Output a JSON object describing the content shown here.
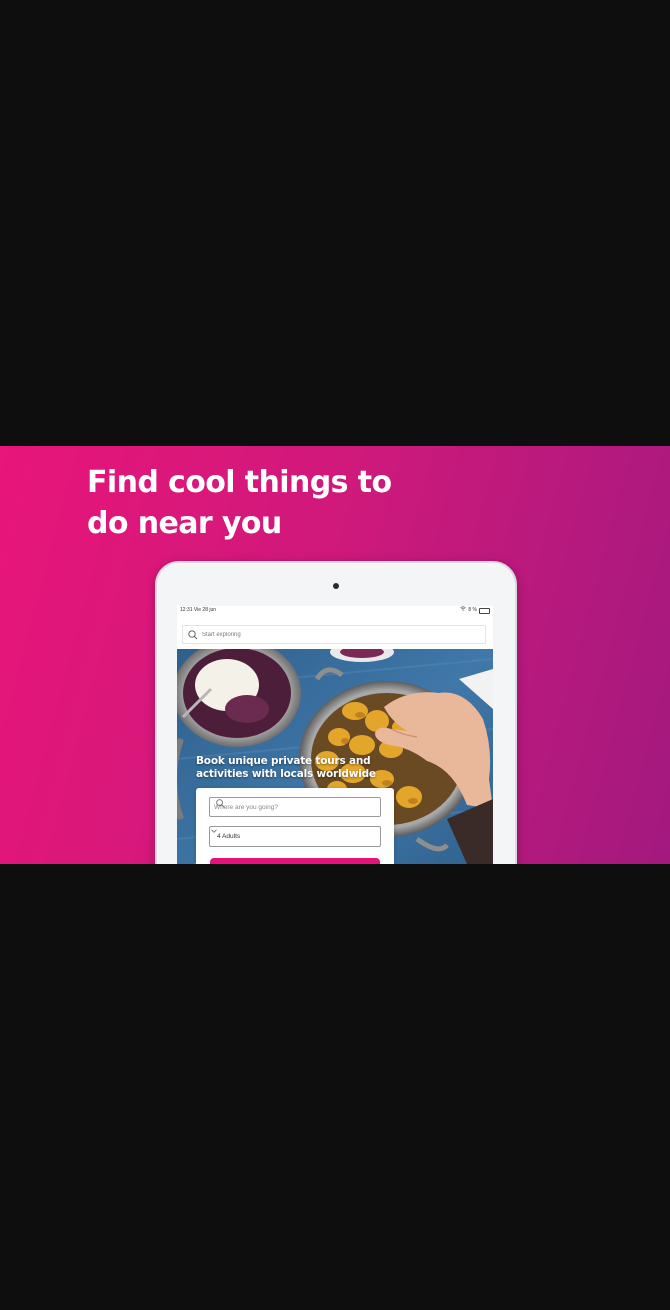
{
  "headline": {
    "line1": "Find cool things to",
    "line2": "do near you"
  },
  "tablet": {
    "status": {
      "time_date": "12:31  Vie 28 jun",
      "battery": "8 %"
    },
    "search": {
      "placeholder": "Start exploring"
    },
    "hero": {
      "line1": "Book unique private tours and",
      "line2": "activities with locals worldwide"
    },
    "booking": {
      "destination_placeholder": "Where are you going?",
      "guests_value": "4 Adults"
    }
  },
  "colors": {
    "background": "#0e0e0f",
    "gradient_start": "#e8157a",
    "gradient_end": "#a3197f",
    "accent": "#e5127a"
  },
  "icons": [
    "search-icon",
    "chevron-down-icon",
    "wifi-icon",
    "battery-icon"
  ]
}
